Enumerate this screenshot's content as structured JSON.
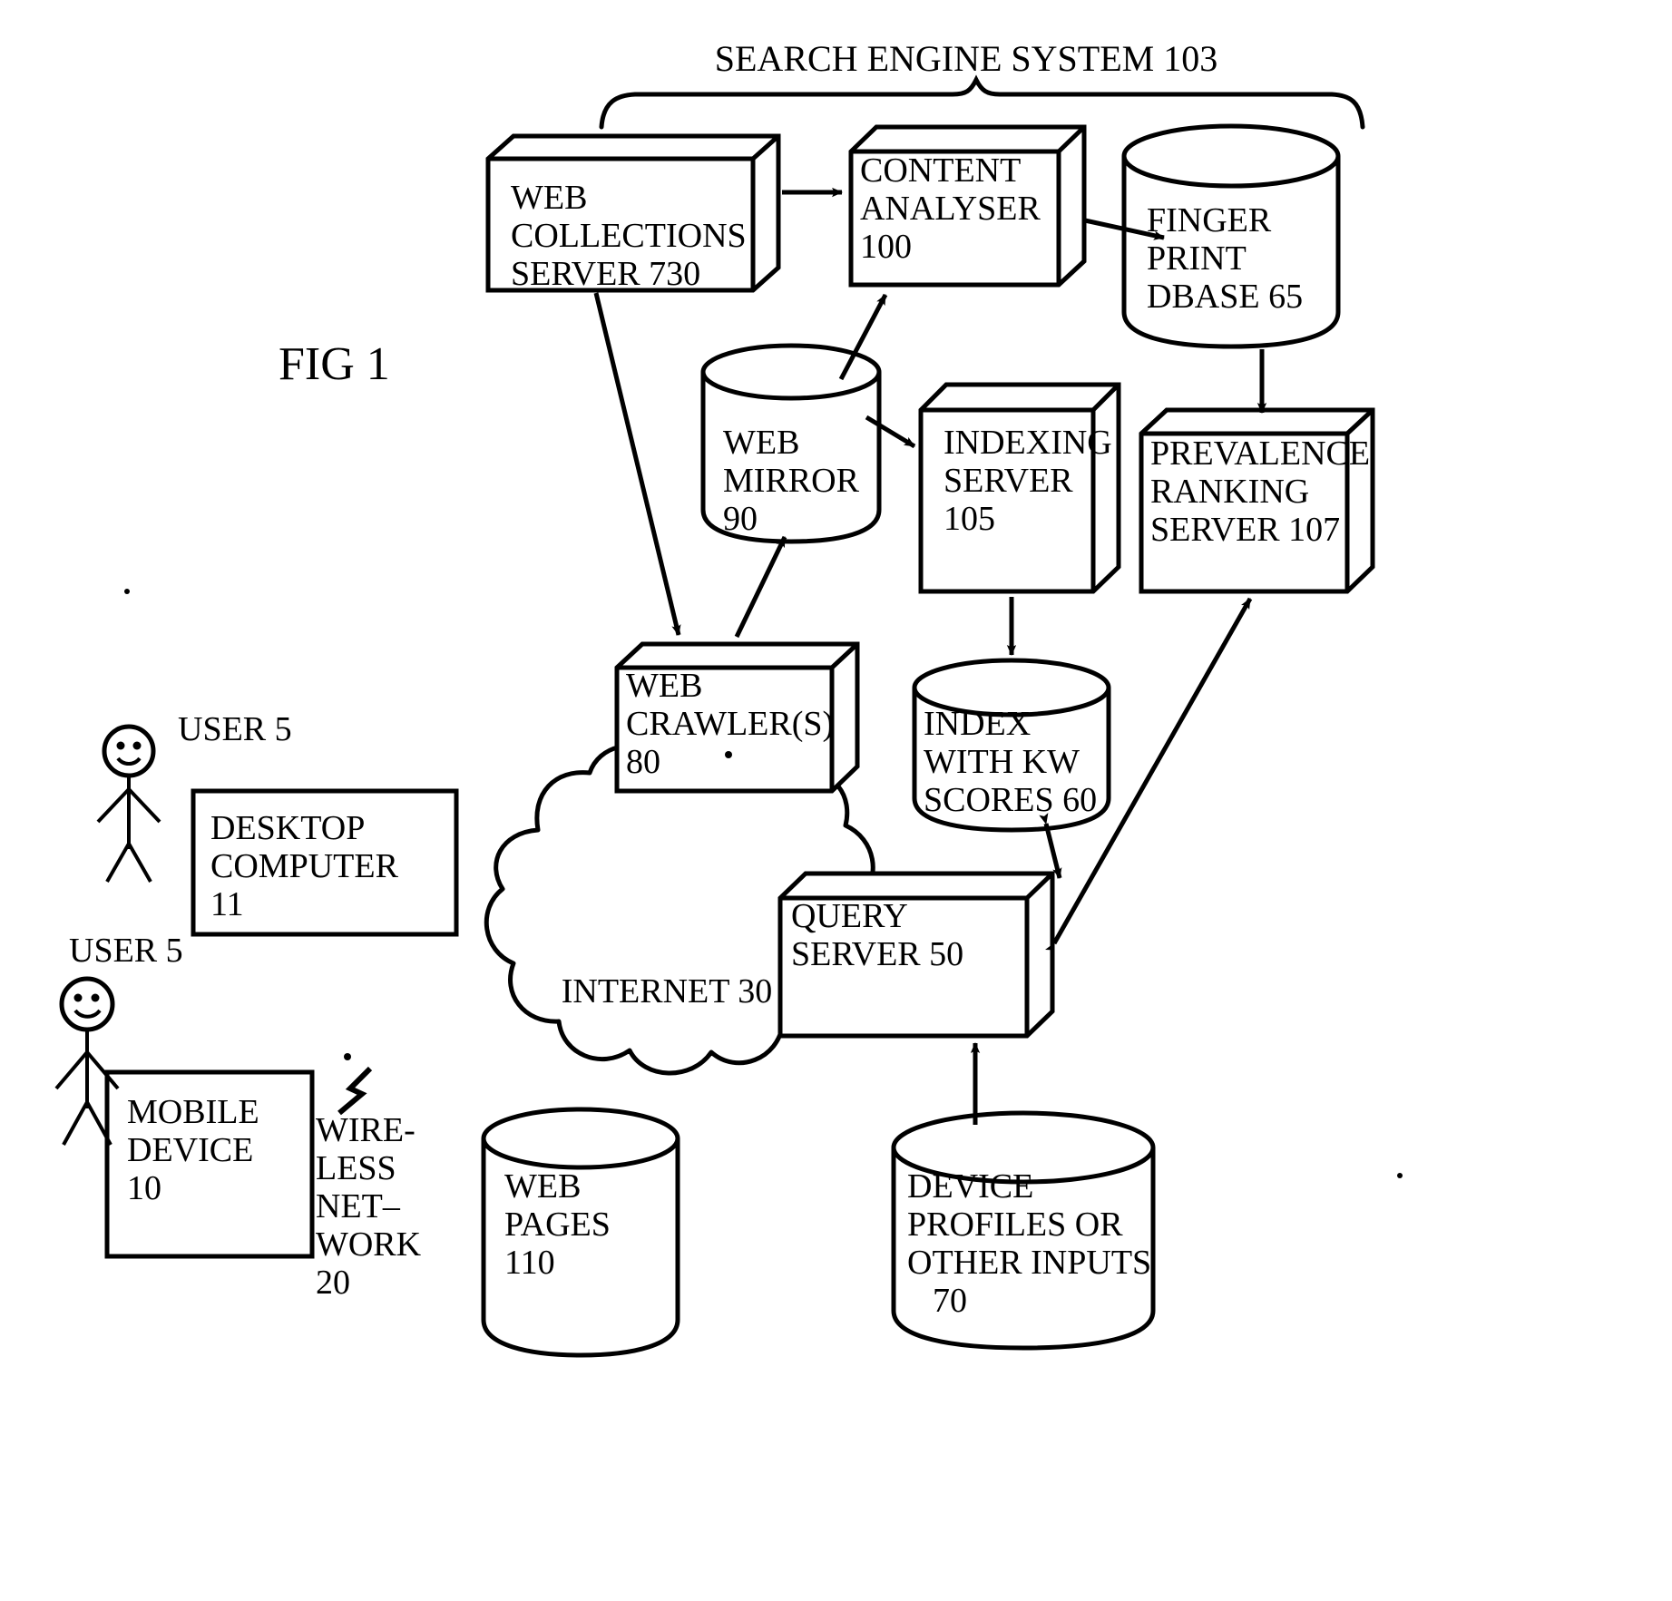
{
  "figure": {
    "label": "FIG 1",
    "system_bracket_label": "SEARCH ENGINE SYSTEM  103"
  },
  "nodes": {
    "web_collections_server": {
      "shape": "box3d",
      "lines": [
        "WEB",
        "COLLECTIONS",
        "SERVER 730"
      ]
    },
    "content_analyser": {
      "shape": "box3d",
      "lines": [
        "CONTENT",
        "ANALYSER",
        "100"
      ]
    },
    "finger_print_dbase": {
      "shape": "cylinder",
      "lines": [
        "FINGER",
        "PRINT",
        "DBASE 65"
      ]
    },
    "web_mirror": {
      "shape": "cylinder",
      "lines": [
        "WEB",
        "MIRROR",
        "90"
      ]
    },
    "indexing_server": {
      "shape": "box3d",
      "lines": [
        "INDEXING",
        "SERVER",
        "105"
      ]
    },
    "prevalence_ranking_server": {
      "shape": "box3d",
      "lines": [
        "PREVALENCE",
        "RANKING",
        "SERVER 107"
      ]
    },
    "web_crawlers": {
      "shape": "box3d",
      "lines": [
        "WEB",
        "CRAWLER(S)",
        "80"
      ]
    },
    "index_with_kw_scores": {
      "shape": "cylinder",
      "lines": [
        "INDEX",
        "WITH KW",
        "SCORES 60"
      ]
    },
    "query_server": {
      "shape": "box3d",
      "lines": [
        "QUERY",
        "SERVER 50"
      ]
    },
    "device_profiles": {
      "shape": "cylinder",
      "lines": [
        "DEVICE",
        "PROFILES OR",
        "OTHER INPUTS",
        "70"
      ]
    },
    "desktop_computer": {
      "shape": "rect",
      "lines": [
        "DESKTOP",
        "COMPUTER",
        "11"
      ]
    },
    "mobile_device": {
      "shape": "rect",
      "lines": [
        "MOBILE",
        "DEVICE",
        "10"
      ]
    },
    "web_pages": {
      "shape": "cylinder",
      "lines": [
        "WEB",
        "PAGES",
        "110"
      ]
    },
    "internet_cloud": {
      "shape": "cloud",
      "lines": [
        "INTERNET 30"
      ]
    },
    "wireless_network": {
      "shape": "text",
      "lines": [
        "WIRE-",
        "LESS",
        "NET–",
        "WORK",
        "20"
      ]
    },
    "user_top": {
      "shape": "stick-figure",
      "lines": [
        "USER 5"
      ]
    },
    "user_bottom": {
      "shape": "stick-figure",
      "lines": [
        "USER 5"
      ]
    }
  },
  "edges": [
    {
      "from": "web_collections_server",
      "to": "content_analyser",
      "style": "arrow"
    },
    {
      "from": "content_analyser",
      "to": "finger_print_dbase",
      "style": "arrow"
    },
    {
      "from": "web_mirror",
      "to": "content_analyser",
      "style": "arrow"
    },
    {
      "from": "finger_print_dbase",
      "to": "prevalence_ranking_server",
      "style": "arrow"
    },
    {
      "from": "web_mirror",
      "to": "indexing_server",
      "style": "arrow"
    },
    {
      "from": "web_collections_server",
      "to": "web_crawlers",
      "style": "arrow"
    },
    {
      "from": "web_crawlers",
      "to": "web_mirror",
      "style": "arrow"
    },
    {
      "from": "indexing_server",
      "to": "index_with_kw_scores",
      "style": "arrow"
    },
    {
      "from": "index_with_kw_scores",
      "to": "query_server",
      "style": "double-arrow"
    },
    {
      "from": "query_server",
      "to": "prevalence_ranking_server",
      "style": "double-arrow"
    },
    {
      "from": "device_profiles",
      "to": "query_server",
      "style": "arrow"
    }
  ],
  "colors": {
    "ink": "#000000",
    "paper": "#ffffff"
  }
}
